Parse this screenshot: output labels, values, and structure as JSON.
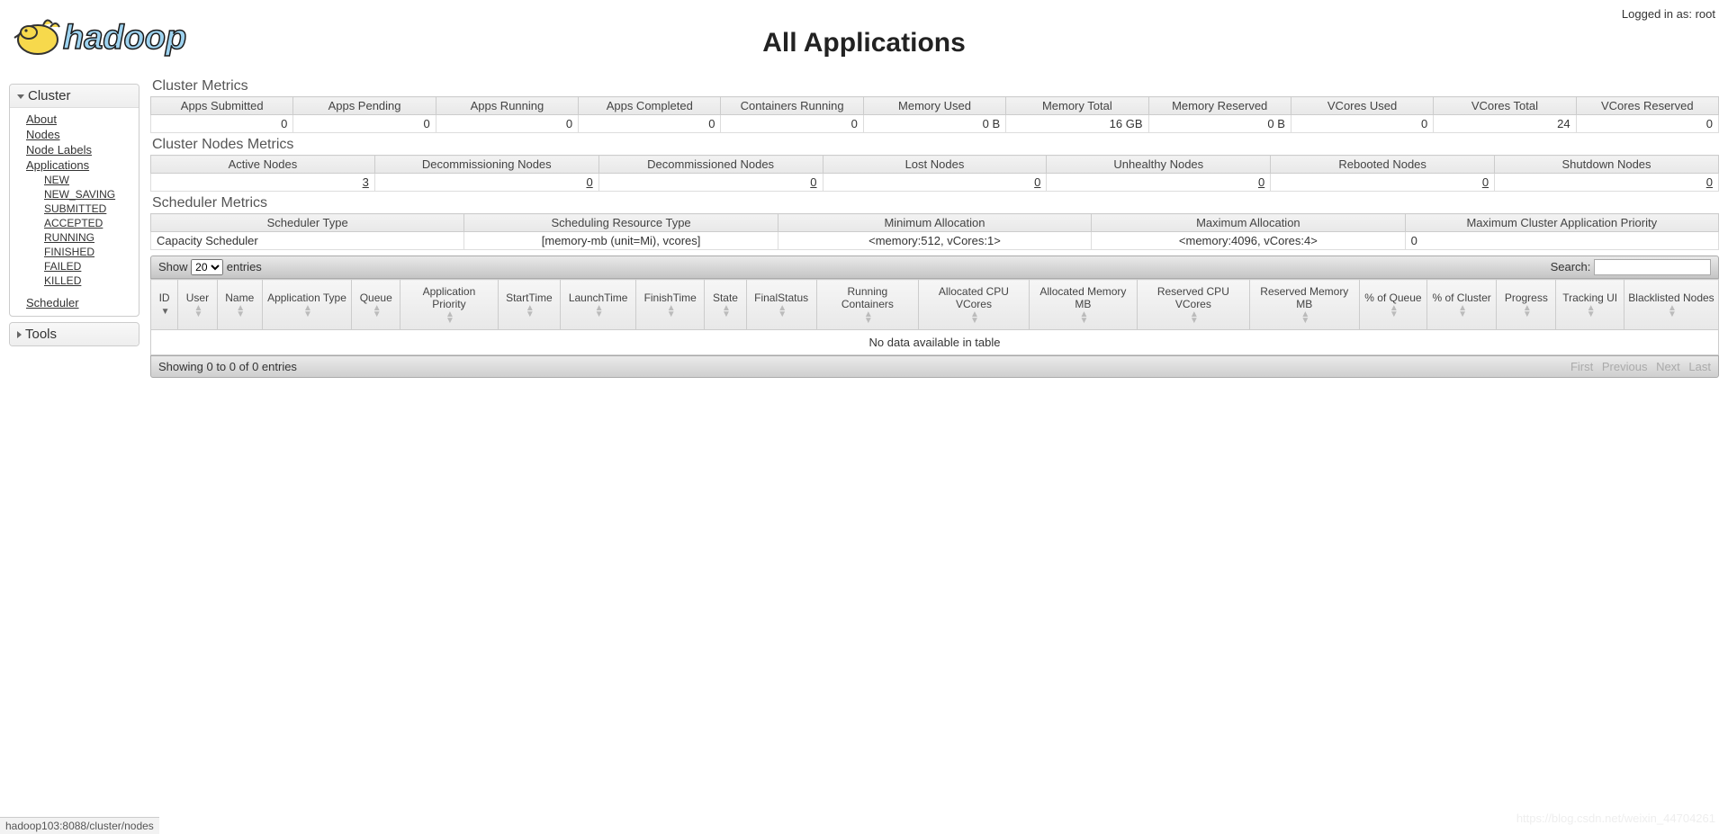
{
  "login_text": "Logged in as: root",
  "page_title": "All Applications",
  "sidebar": {
    "cluster_header": "Cluster",
    "tools_header": "Tools",
    "links": {
      "about": "About",
      "nodes": "Nodes",
      "node_labels": "Node Labels",
      "applications": "Applications",
      "scheduler": "Scheduler"
    },
    "app_states": [
      "NEW",
      "NEW_SAVING",
      "SUBMITTED",
      "ACCEPTED",
      "RUNNING",
      "FINISHED",
      "FAILED",
      "KILLED"
    ]
  },
  "cluster_metrics": {
    "title": "Cluster Metrics",
    "headers": [
      "Apps Submitted",
      "Apps Pending",
      "Apps Running",
      "Apps Completed",
      "Containers Running",
      "Memory Used",
      "Memory Total",
      "Memory Reserved",
      "VCores Used",
      "VCores Total",
      "VCores Reserved"
    ],
    "values": [
      "0",
      "0",
      "0",
      "0",
      "0",
      "0 B",
      "16 GB",
      "0 B",
      "0",
      "24",
      "0"
    ]
  },
  "node_metrics": {
    "title": "Cluster Nodes Metrics",
    "headers": [
      "Active Nodes",
      "Decommissioning Nodes",
      "Decommissioned Nodes",
      "Lost Nodes",
      "Unhealthy Nodes",
      "Rebooted Nodes",
      "Shutdown Nodes"
    ],
    "values": [
      "3",
      "0",
      "0",
      "0",
      "0",
      "0",
      "0"
    ]
  },
  "scheduler_metrics": {
    "title": "Scheduler Metrics",
    "headers": [
      "Scheduler Type",
      "Scheduling Resource Type",
      "Minimum Allocation",
      "Maximum Allocation",
      "Maximum Cluster Application Priority"
    ],
    "values": [
      "Capacity Scheduler",
      "[memory-mb (unit=Mi), vcores]",
      "<memory:512, vCores:1>",
      "<memory:4096, vCores:4>",
      "0"
    ]
  },
  "datatable": {
    "show_label_prefix": "Show",
    "show_label_suffix": "entries",
    "page_size": "20",
    "search_label": "Search:",
    "columns": [
      "ID",
      "User",
      "Name",
      "Application Type",
      "Queue",
      "Application Priority",
      "StartTime",
      "LaunchTime",
      "FinishTime",
      "State",
      "FinalStatus",
      "Running Containers",
      "Allocated CPU VCores",
      "Allocated Memory MB",
      "Reserved CPU VCores",
      "Reserved Memory MB",
      "% of Queue",
      "% of Cluster",
      "Progress",
      "Tracking UI",
      "Blacklisted Nodes"
    ],
    "no_data": "No data available in table",
    "info": "Showing 0 to 0 of 0 entries",
    "pager": [
      "First",
      "Previous",
      "Next",
      "Last"
    ]
  },
  "statusbar": "hadoop103:8088/cluster/nodes",
  "watermark": "https://blog.csdn.net/weixin_44704261"
}
